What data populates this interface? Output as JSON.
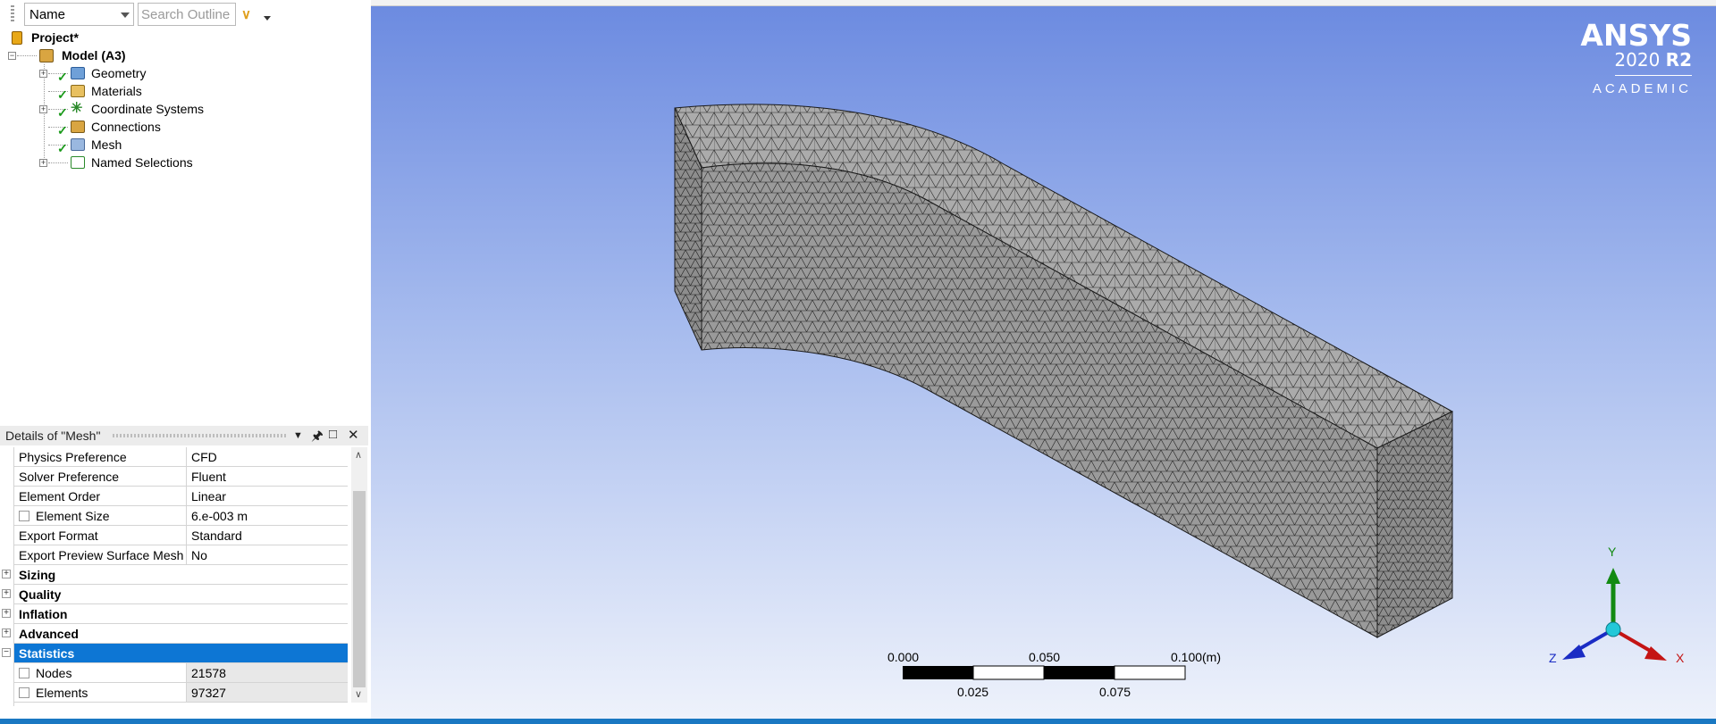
{
  "outline_toolbar": {
    "filter_select_value": "Name",
    "search_placeholder": "Search Outline"
  },
  "tree": {
    "project": "Project*",
    "model": "Model (A3)",
    "items": [
      {
        "label": "Geometry",
        "icon": "geometry-icon"
      },
      {
        "label": "Materials",
        "icon": "materials-icon"
      },
      {
        "label": "Coordinate Systems",
        "icon": "coordinate-systems-icon"
      },
      {
        "label": "Connections",
        "icon": "connections-icon"
      },
      {
        "label": "Mesh",
        "icon": "mesh-icon"
      },
      {
        "label": "Named Selections",
        "icon": "named-selections-icon"
      }
    ]
  },
  "details": {
    "title": "Details of \"Mesh\"",
    "rows": [
      {
        "key": "Physics Preference",
        "value": "CFD"
      },
      {
        "key": "Solver Preference",
        "value": "Fluent"
      },
      {
        "key": "Element Order",
        "value": "Linear"
      },
      {
        "key": "Element Size",
        "value": "6.e-003 m"
      },
      {
        "key": "Export Format",
        "value": "Standard"
      },
      {
        "key": "Export Preview Surface Mesh",
        "value": "No"
      }
    ],
    "categories": [
      "Sizing",
      "Quality",
      "Inflation",
      "Advanced",
      "Statistics"
    ],
    "stats": [
      {
        "key": "Nodes",
        "value": "21578"
      },
      {
        "key": "Elements",
        "value": "97327"
      }
    ]
  },
  "viewport": {
    "logo": {
      "brand": "ANSYS",
      "version": "2020",
      "release": "R2",
      "edition": "ACADEMIC"
    },
    "scale": {
      "labels_top": [
        "0.000",
        "0.050",
        "0.100"
      ],
      "unit": "(m)",
      "labels_bottom": [
        "0.025",
        "0.075"
      ]
    },
    "triad": {
      "x": "X",
      "y": "Y",
      "z": "Z"
    }
  },
  "colors": {
    "selection": "#0d76d4",
    "check": "#1a9a1a",
    "viewport_top": "#6b8ae0",
    "viewport_bottom": "#eef2fb",
    "bottom_bar": "#1a78c2"
  }
}
